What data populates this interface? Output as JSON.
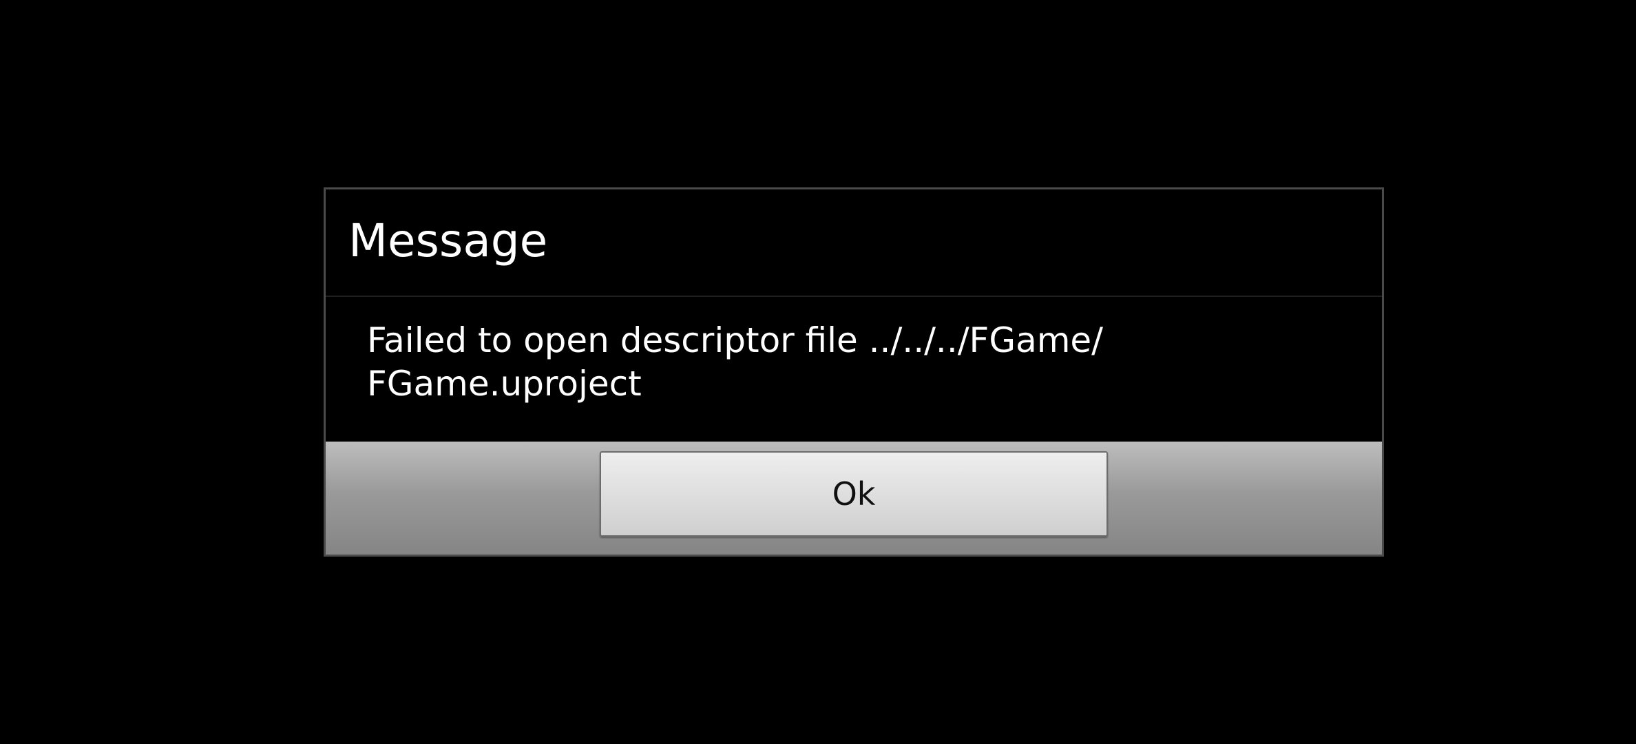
{
  "dialog": {
    "title": "Message",
    "message": "Failed to open descriptor file ../../../FGame/ FGame.uproject",
    "ok_label": "Ok"
  }
}
